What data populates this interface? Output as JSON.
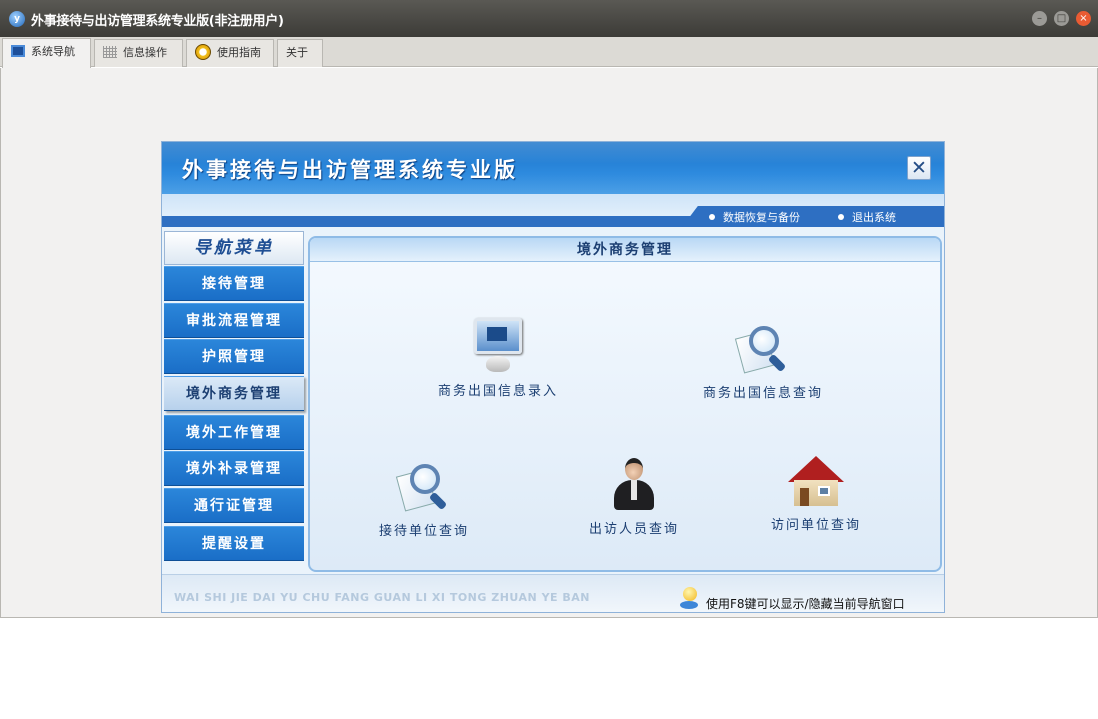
{
  "window": {
    "title": "外事接待与出访管理系统专业版(非注册用户)",
    "app_icon": "yf-app-icon",
    "controls": [
      "minimize",
      "maximize",
      "close"
    ]
  },
  "tabs": [
    {
      "label": "系统导航",
      "icon": "monitor-icon",
      "active": true
    },
    {
      "label": "信息操作",
      "icon": "grid-icon",
      "active": false
    },
    {
      "label": "使用指南",
      "icon": "help-ring-icon",
      "active": false
    },
    {
      "label": "关于",
      "icon": null,
      "active": false
    }
  ],
  "panel": {
    "title": "外事接待与出访管理系统专业版",
    "links": [
      "数据恢复与备份",
      "退出系统"
    ]
  },
  "nav": {
    "heading": "导航菜单",
    "items": [
      "接待管理",
      "审批流程管理",
      "护照管理",
      "境外商务管理",
      "境外工作管理",
      "境外补录管理",
      "通行证管理",
      "提醒设置"
    ],
    "active_index": 3
  },
  "content": {
    "title": "境外商务管理",
    "functions": [
      {
        "label": "商务出国信息录入",
        "icon": "monitor-icon"
      },
      {
        "label": "商务出国信息查询",
        "icon": "magnifier-icon"
      },
      {
        "label": "接待单位查询",
        "icon": "magnifier-icon"
      },
      {
        "label": "出访人员查询",
        "icon": "person-icon"
      },
      {
        "label": "访问单位查询",
        "icon": "house-icon"
      }
    ]
  },
  "footer": {
    "pinyin": "WAI SHI JIE DAI YU CHU FANG GUAN LI XI TONG ZHUAN YE BAN",
    "tip": "使用F8键可以显示/隐藏当前导航窗口"
  },
  "colors": {
    "header_blue": "#1a73c9",
    "nav_blue": "#2b86da",
    "content_text": "#1c3f72",
    "close_red": "#e95b33"
  }
}
